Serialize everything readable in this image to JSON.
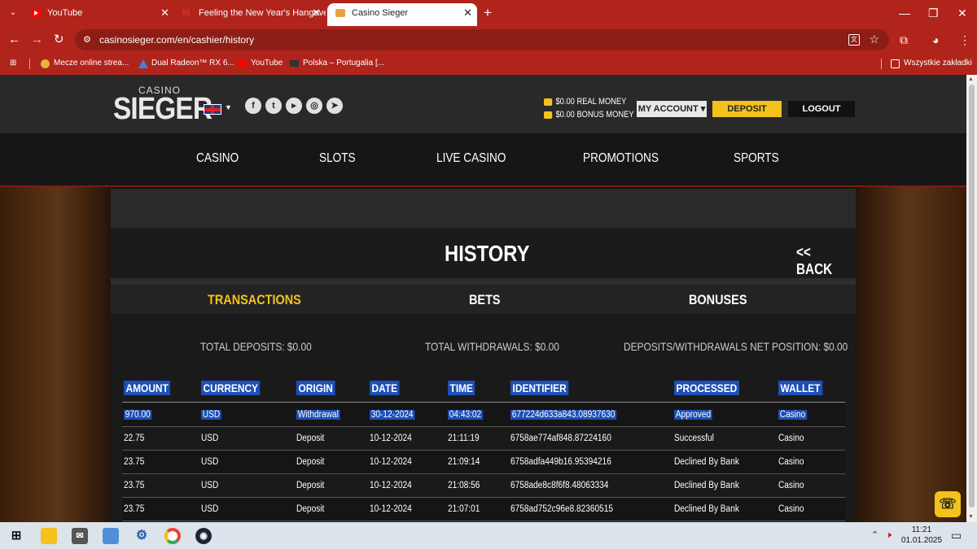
{
  "browser": {
    "tabs": [
      {
        "label": "YouTube",
        "icon": "youtube-icon"
      },
      {
        "label": "Feeling the New Year's Hangover",
        "icon": "gmail-icon"
      },
      {
        "label": "Casino Sieger",
        "icon": "casino-icon"
      }
    ],
    "url": "casinosieger.com/en/cashier/history",
    "bookmarks": [
      {
        "label": "Mecze online strea..."
      },
      {
        "label": "Dual Radeon™ RX 6..."
      },
      {
        "label": "YouTube"
      },
      {
        "label": "Polska – Portugalia [..."
      }
    ],
    "all_bookmarks": "Wszystkie zakładki",
    "accent": "#b0241b"
  },
  "header": {
    "logo_top": "CASINO",
    "logo_main": "SIEGER",
    "real_money": "$0.00 REAL MONEY",
    "bonus_money": "$0.00 BONUS MONEY",
    "my_account": "MY ACCOUNT ▾",
    "deposit": "DEPOSIT",
    "logout": "LOGOUT",
    "brand_color": "#f3c21b"
  },
  "nav": {
    "items": [
      "CASINO",
      "SLOTS",
      "LIVE CASINO",
      "PROMOTIONS",
      "SPORTS"
    ]
  },
  "history": {
    "title": "HISTORY",
    "back": "<< BACK",
    "tabs": [
      "TRANSACTIONS",
      "BETS",
      "BONUSES"
    ],
    "total_deposits": "TOTAL DEPOSITS: $0.00",
    "total_withdrawals": "TOTAL WITHDRAWALS: $0.00",
    "net_position": "DEPOSITS/WITHDRAWALS NET POSITION: $0.00",
    "columns": [
      "AMOUNT",
      "CURRENCY",
      "ORIGIN",
      "DATE",
      "TIME",
      "IDENTIFIER",
      "PROCESSED",
      "WALLET"
    ],
    "rows": [
      [
        "970.00",
        "USD",
        "Withdrawal",
        "30-12-2024",
        "04:43:02",
        "677224d633a843.08937630",
        "Approved",
        "Casino"
      ],
      [
        "22.75",
        "USD",
        "Deposit",
        "10-12-2024",
        "21:11:19",
        "6758ae774af848.87224160",
        "Successful",
        "Casino"
      ],
      [
        "23.75",
        "USD",
        "Deposit",
        "10-12-2024",
        "21:09:14",
        "6758adfa449b16.95394216",
        "Declined By Bank",
        "Casino"
      ],
      [
        "23.75",
        "USD",
        "Deposit",
        "10-12-2024",
        "21:08:56",
        "6758ade8c8f6f8.48063334",
        "Declined By Bank",
        "Casino"
      ],
      [
        "23.75",
        "USD",
        "Deposit",
        "10-12-2024",
        "21:07:01",
        "6758ad752c96e8.82360515",
        "Declined By Bank",
        "Casino"
      ]
    ]
  },
  "taskbar": {
    "time": "11:21",
    "date": "01.01.2025"
  }
}
